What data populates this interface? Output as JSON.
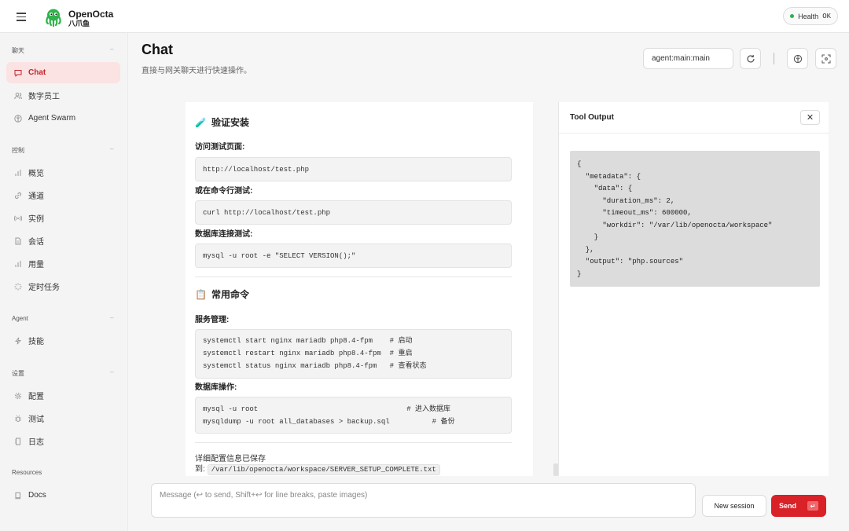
{
  "brand": {
    "name": "OpenOcta",
    "subtitle": "八爪鱼"
  },
  "health": {
    "label": "Health",
    "status": "OK"
  },
  "sidebar": {
    "sections": [
      {
        "title": "聊天",
        "items": [
          {
            "label": "Chat",
            "icon": "chat-bubble-icon",
            "active": true
          },
          {
            "label": "数字员工",
            "icon": "users-icon"
          },
          {
            "label": "Agent Swarm",
            "icon": "swarm-icon"
          }
        ]
      },
      {
        "title": "控制",
        "items": [
          {
            "label": "概览",
            "icon": "bar-chart-icon"
          },
          {
            "label": "通道",
            "icon": "link-icon"
          },
          {
            "label": "实例",
            "icon": "broadcast-icon"
          },
          {
            "label": "会话",
            "icon": "document-icon"
          },
          {
            "label": "用量",
            "icon": "bar-chart-icon"
          },
          {
            "label": "定时任务",
            "icon": "loader-icon"
          }
        ]
      },
      {
        "title": "Agent",
        "items": [
          {
            "label": "技能",
            "icon": "bolt-icon"
          }
        ]
      },
      {
        "title": "设置",
        "items": [
          {
            "label": "配置",
            "icon": "gear-icon"
          },
          {
            "label": "测试",
            "icon": "bug-icon"
          },
          {
            "label": "日志",
            "icon": "log-icon"
          }
        ]
      },
      {
        "title": "Resources",
        "items": [
          {
            "label": "Docs",
            "icon": "book-icon"
          }
        ]
      }
    ]
  },
  "header": {
    "title": "Chat",
    "subtitle": "直接与网关聊天进行快速操作。",
    "session_key": "agent:main:main"
  },
  "chat": {
    "section1_icon": "🧪",
    "section1_title": "验证安装",
    "label_visit": "访问测试页面:",
    "code_visit": "http://localhost/test.php",
    "label_cli": "或在命令行测试:",
    "code_cli": "curl http://localhost/test.php",
    "label_db_test": "数据库连接测试:",
    "code_db_test": "mysql -u root -e \"SELECT VERSION();\"",
    "section2_icon": "📋",
    "section2_title": "常用命令",
    "label_service": "服务管理:",
    "service_lines": [
      "systemctl start nginx mariadb php8.4-fpm    # 启动",
      "systemctl restart nginx mariadb php8.4-fpm  # 重启",
      "systemctl status nginx mariadb php8.4-fpm   # 查看状态"
    ],
    "label_db_ops": "数据库操作:",
    "db_lines": [
      "mysql -u root                                   # 进入数据库",
      "mysqldump -u root all_databases > backup.sql          # 备份"
    ],
    "saved_text": "详细配置信息已保存",
    "saved_prefix": "到:",
    "saved_path": "/var/lib/openocta/workspace/SERVER_SETUP_COMPLETE.txt"
  },
  "tool_output": {
    "title": "Tool Output",
    "json_lines": [
      "{",
      "  \"metadata\": {",
      "    \"data\": {",
      "      \"duration_ms\": 2,",
      "      \"timeout_ms\": 600000,",
      "      \"workdir\": \"/var/lib/openocta/workspace\"",
      "    }",
      "  },",
      "  \"output\": \"php.sources\"",
      "}"
    ]
  },
  "composer": {
    "placeholder": "Message (↩ to send, Shift+↩ for line breaks, paste images)",
    "new_session": "New session",
    "send": "Send",
    "send_key": "↵"
  },
  "colors": {
    "accent": "#d92128",
    "active_bg": "#fbe3e3",
    "health_dot": "#2bb24c"
  }
}
